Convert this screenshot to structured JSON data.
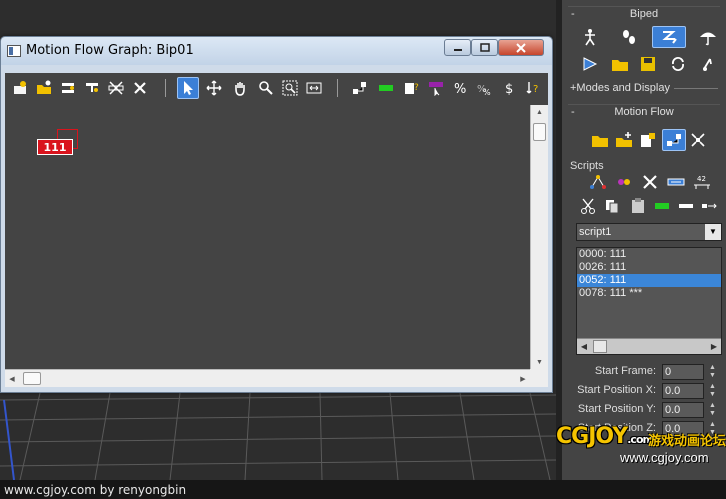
{
  "window": {
    "title": "Motion Flow Graph: Bip01",
    "node_label": "111"
  },
  "panel": {
    "biped_title": "Biped",
    "biped_minus": "-",
    "modes_display": "+Modes and Display",
    "motion_flow_title": "Motion Flow",
    "motion_flow_minus": "-",
    "scripts_label": "Scripts",
    "script_selected": "script1",
    "script_items": [
      {
        "text": "0000: 111"
      },
      {
        "text": "0026: 111"
      },
      {
        "text": "0052: 111"
      },
      {
        "text": "0078: 111 ***"
      }
    ],
    "fields": [
      {
        "label": "Start Frame:",
        "value": "0"
      },
      {
        "label": "Start Position X:",
        "value": "0.0"
      },
      {
        "label": "Start Position Y:",
        "value": "0.0"
      },
      {
        "label": "Start Position Z:",
        "value": "0.0"
      }
    ]
  },
  "footer": {
    "credit": "www.cgjoy.com by renyongbin"
  },
  "watermark": {
    "logo": "CGJOY",
    "logo_suffix": ".com",
    "chinese": "游戏动画论坛",
    "url": "www.cgjoy.com"
  },
  "colors": {
    "accent": "#3b7fd6",
    "node_red": "#d9141d",
    "selected_row": "#3b86d8"
  }
}
